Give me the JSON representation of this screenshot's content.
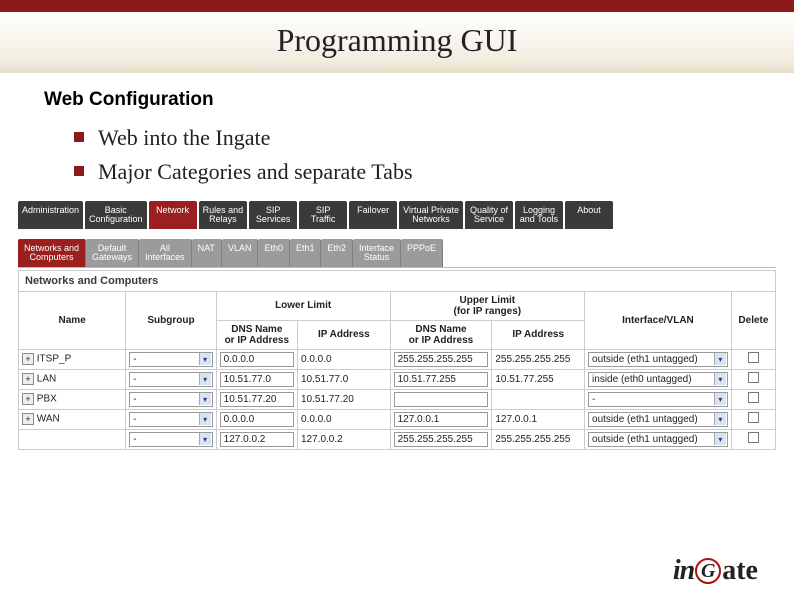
{
  "title": "Programming GUI",
  "subhead": "Web Configuration",
  "bullets": [
    "Web into the Ingate",
    "Major Categories and separate Tabs"
  ],
  "tabs": [
    "Administration",
    "Basic\nConfiguration",
    "Network",
    "Rules and\nRelays",
    "SIP\nServices",
    "SIP\nTraffic",
    "Failover",
    "Virtual Private\nNetworks",
    "Quality of\nService",
    "Logging\nand Tools",
    "About"
  ],
  "active_tab": 2,
  "subtabs": [
    "Networks and\nComputers",
    "Default\nGateways",
    "All\nInterfaces",
    "NAT",
    "VLAN",
    "Eth0",
    "Eth1",
    "Eth2",
    "Interface\nStatus",
    "PPPoE"
  ],
  "active_subtab": 0,
  "panel_label": "Networks and Computers",
  "columns": {
    "name": "Name",
    "subgroup": "Subgroup",
    "lower": "Lower Limit",
    "upper": "Upper Limit\n(for IP ranges)",
    "dns": "DNS Name\nor IP Address",
    "ip": "IP Address",
    "iface": "Interface/VLAN",
    "delete": "Delete"
  },
  "rows": [
    {
      "name": "ITSP_P",
      "subgroup": "-",
      "ldns": "0.0.0.0",
      "lip": "0.0.0.0",
      "udns": "255.255.255.255",
      "uip": "255.255.255.255",
      "iface": "outside (eth1 untagged)",
      "del": false
    },
    {
      "name": "LAN",
      "subgroup": "-",
      "ldns": "10.51.77.0",
      "lip": "10.51.77.0",
      "udns": "10.51.77.255",
      "uip": "10.51.77.255",
      "iface": "inside (eth0 untagged)",
      "del": false
    },
    {
      "name": "PBX",
      "subgroup": "-",
      "ldns": "10.51.77.20",
      "lip": "10.51.77.20",
      "udns": "",
      "uip": "",
      "iface": "-",
      "del": false
    },
    {
      "name": "WAN",
      "subgroup": "-",
      "ldns": "0.0.0.0",
      "lip": "0.0.0.0",
      "udns": "127.0.0.1",
      "uip": "127.0.0.1",
      "iface": "outside (eth1 untagged)",
      "del": false
    },
    {
      "name": "",
      "subgroup": "-",
      "ldns": "127.0.0.2",
      "lip": "127.0.0.2",
      "udns": "255.255.255.255",
      "uip": "255.255.255.255",
      "iface": "outside (eth1 untagged)",
      "del": false
    }
  ],
  "logo": {
    "pre": "in",
    "mid": "G",
    "suf": "ate"
  }
}
